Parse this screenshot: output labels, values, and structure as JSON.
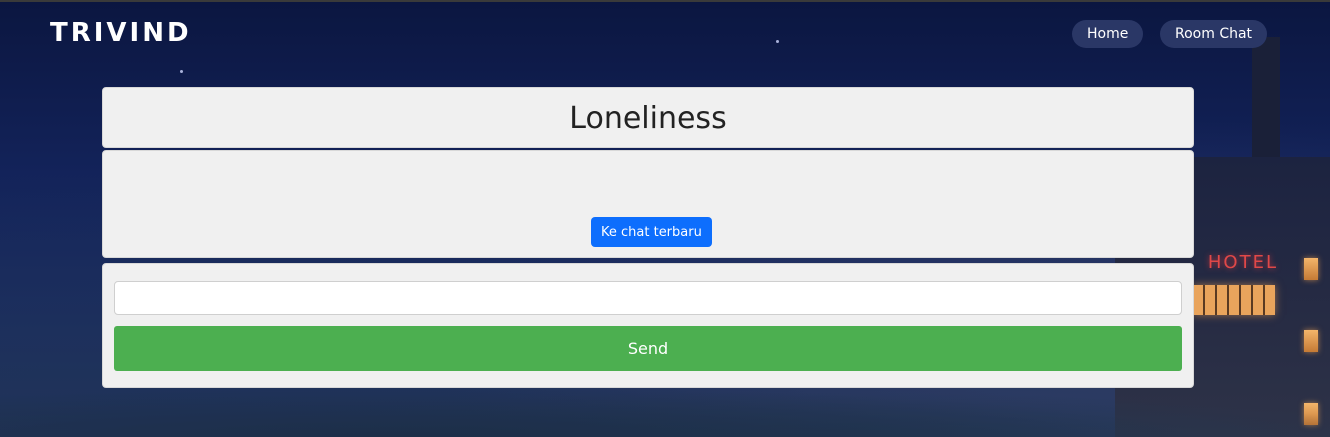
{
  "navbar": {
    "brand": "TRIVIND",
    "links": [
      {
        "label": "Home"
      },
      {
        "label": "Room Chat"
      }
    ]
  },
  "room": {
    "title": "Loneliness"
  },
  "messages": {
    "jump_latest_label": "Ke chat terbaru"
  },
  "composer": {
    "input_value": "",
    "send_label": "Send"
  },
  "background": {
    "sign_text": "HOTEL"
  },
  "colors": {
    "send_button": "#4caf50",
    "jump_button": "#0d6efd",
    "nav_pill": "#2a3766",
    "card": "#f0f0f0"
  }
}
